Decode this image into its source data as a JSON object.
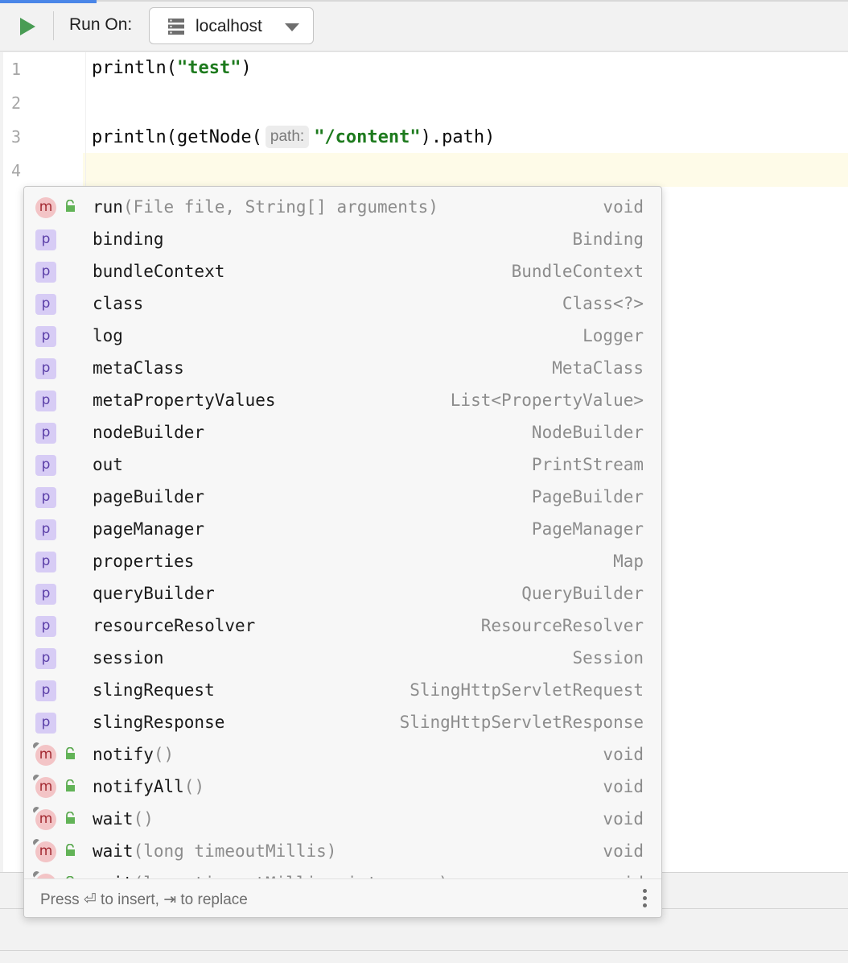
{
  "toolbar": {
    "run_on_label": "Run On:",
    "host": "localhost"
  },
  "editor": {
    "lines": [
      {
        "num": "1",
        "parts": [
          {
            "t": "println(",
            "c": "plain"
          },
          {
            "t": "\"test\"",
            "c": "str"
          },
          {
            "t": ")",
            "c": "plain"
          }
        ]
      },
      {
        "num": "2",
        "parts": []
      },
      {
        "num": "3",
        "parts": [
          {
            "t": "println(getNode(",
            "c": "plain"
          },
          {
            "t": "path:",
            "c": "hint"
          },
          {
            "t": "\"/content\"",
            "c": "str"
          },
          {
            "t": ").path)",
            "c": "plain"
          }
        ]
      },
      {
        "num": "4",
        "parts": []
      }
    ]
  },
  "completion": {
    "items": [
      {
        "kind": "m",
        "lock": true,
        "override": false,
        "name": "run",
        "sig": "(File file, String[] arguments)",
        "type": "void"
      },
      {
        "kind": "p",
        "lock": false,
        "override": false,
        "name": "binding",
        "sig": "",
        "type": "Binding"
      },
      {
        "kind": "p",
        "lock": false,
        "override": false,
        "name": "bundleContext",
        "sig": "",
        "type": "BundleContext"
      },
      {
        "kind": "p",
        "lock": false,
        "override": false,
        "name": "class",
        "sig": "",
        "type": "Class<?>"
      },
      {
        "kind": "p",
        "lock": false,
        "override": false,
        "name": "log",
        "sig": "",
        "type": "Logger"
      },
      {
        "kind": "p",
        "lock": false,
        "override": false,
        "name": "metaClass",
        "sig": "",
        "type": "MetaClass"
      },
      {
        "kind": "p",
        "lock": false,
        "override": false,
        "name": "metaPropertyValues",
        "sig": "",
        "type": "List<PropertyValue>"
      },
      {
        "kind": "p",
        "lock": false,
        "override": false,
        "name": "nodeBuilder",
        "sig": "",
        "type": "NodeBuilder"
      },
      {
        "kind": "p",
        "lock": false,
        "override": false,
        "name": "out",
        "sig": "",
        "type": "PrintStream"
      },
      {
        "kind": "p",
        "lock": false,
        "override": false,
        "name": "pageBuilder",
        "sig": "",
        "type": "PageBuilder"
      },
      {
        "kind": "p",
        "lock": false,
        "override": false,
        "name": "pageManager",
        "sig": "",
        "type": "PageManager"
      },
      {
        "kind": "p",
        "lock": false,
        "override": false,
        "name": "properties",
        "sig": "",
        "type": "Map"
      },
      {
        "kind": "p",
        "lock": false,
        "override": false,
        "name": "queryBuilder",
        "sig": "",
        "type": "QueryBuilder"
      },
      {
        "kind": "p",
        "lock": false,
        "override": false,
        "name": "resourceResolver",
        "sig": "",
        "type": "ResourceResolver"
      },
      {
        "kind": "p",
        "lock": false,
        "override": false,
        "name": "session",
        "sig": "",
        "type": "Session"
      },
      {
        "kind": "p",
        "lock": false,
        "override": false,
        "name": "slingRequest",
        "sig": "",
        "type": "SlingHttpServletRequest"
      },
      {
        "kind": "p",
        "lock": false,
        "override": false,
        "name": "slingResponse",
        "sig": "",
        "type": "SlingHttpServletResponse"
      },
      {
        "kind": "m",
        "lock": true,
        "override": true,
        "name": "notify",
        "sig": "()",
        "type": "void"
      },
      {
        "kind": "m",
        "lock": true,
        "override": true,
        "name": "notifyAll",
        "sig": "()",
        "type": "void"
      },
      {
        "kind": "m",
        "lock": true,
        "override": true,
        "name": "wait",
        "sig": "()",
        "type": "void"
      },
      {
        "kind": "m",
        "lock": true,
        "override": true,
        "name": "wait",
        "sig": "(long timeoutMillis)",
        "type": "void"
      },
      {
        "kind": "m",
        "lock": true,
        "override": true,
        "name": "wait",
        "sig": "(long timeoutMillis, int nanos)",
        "type": "void"
      }
    ],
    "footer_hint": "Press ⏎ to insert, ⇥ to replace"
  },
  "colors": {
    "run_green": "#499c54",
    "string_green": "#1d7a1d",
    "property_badge": "#d7ccf5",
    "method_badge": "#f3c4c6",
    "current_line": "#fefbe8"
  }
}
